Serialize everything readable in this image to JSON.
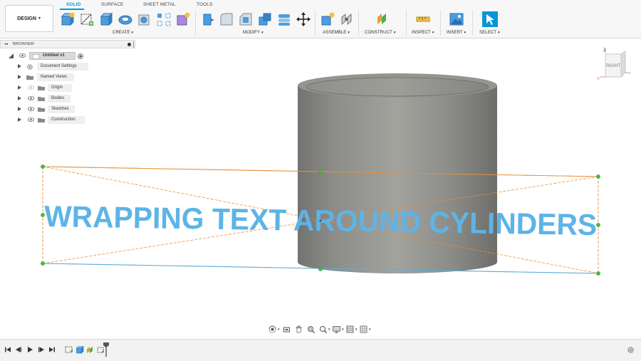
{
  "toolbar": {
    "workspace_button": "DESIGN",
    "tabs": [
      "SOLID",
      "SURFACE",
      "SHEET METAL",
      "TOOLS"
    ],
    "active_tab": "SOLID",
    "groups": [
      "CREATE",
      "MODIFY",
      "ASSEMBLE",
      "CONSTRUCT",
      "INSPECT",
      "INSERT",
      "SELECT"
    ],
    "accent_color": "#0696d7"
  },
  "browser": {
    "title": "BROWSER",
    "root_item": "Untitled v1",
    "items": [
      "Document Settings",
      "Named Views",
      "Origin",
      "Bodies",
      "Sketches",
      "Construction"
    ]
  },
  "viewcube": {
    "face_label": "RIGHT",
    "axis_z": "Z",
    "axis_y": "Y",
    "axis_x": "X"
  },
  "canvas": {
    "overlay_text": "WRAPPING TEXT AROUND CYLINDERS",
    "overlay_color": "#5db4e6",
    "body_color": "#8f8f8a",
    "sketch_line_color": "#e8913a",
    "sketch_point_color": "#3fc03f"
  },
  "navbar": {
    "icons": [
      "orbit-icon",
      "look-at-icon",
      "pan-icon",
      "zoom-icon",
      "display-settings-icon",
      "visual-style-icon",
      "grid-icon"
    ]
  },
  "timeline": {
    "controls": [
      "go-to-start-icon",
      "step-back-icon",
      "play-icon",
      "step-forward-icon",
      "go-to-end-icon"
    ],
    "features": [
      "sketch-feature-icon",
      "extrude-feature-icon",
      "shell-feature-icon",
      "emboss-feature-icon"
    ]
  }
}
